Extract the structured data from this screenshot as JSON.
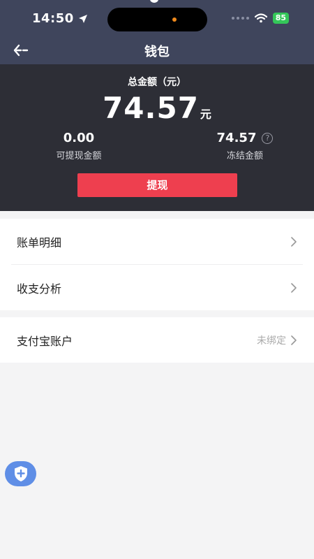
{
  "status_bar": {
    "time": "14:50",
    "battery": "85"
  },
  "nav": {
    "title": "钱包"
  },
  "summary": {
    "total_label": "总金额（元）",
    "total_amount": "74.57",
    "total_unit": "元",
    "withdrawable_value": "0.00",
    "withdrawable_label": "可提现金额",
    "frozen_value": "74.57",
    "frozen_label": "冻结金额",
    "withdraw_button": "提现"
  },
  "menu": {
    "bill_details": "账单明细",
    "income_expense": "收支分析",
    "alipay_label": "支付宝账户",
    "alipay_status": "未绑定"
  },
  "colors": {
    "header_bg": "#3f455c",
    "summary_bg": "#2d2e36",
    "accent_red": "#ee3f4f",
    "battery_green": "#34c759",
    "fab_blue": "#5f8ee6"
  },
  "icons": {
    "back": "back-arrow-icon",
    "location": "location-arrow-icon",
    "wifi": "wifi-icon",
    "help": "question-circle-icon",
    "chevron": "chevron-right-icon",
    "fab": "shield-plus-icon"
  }
}
